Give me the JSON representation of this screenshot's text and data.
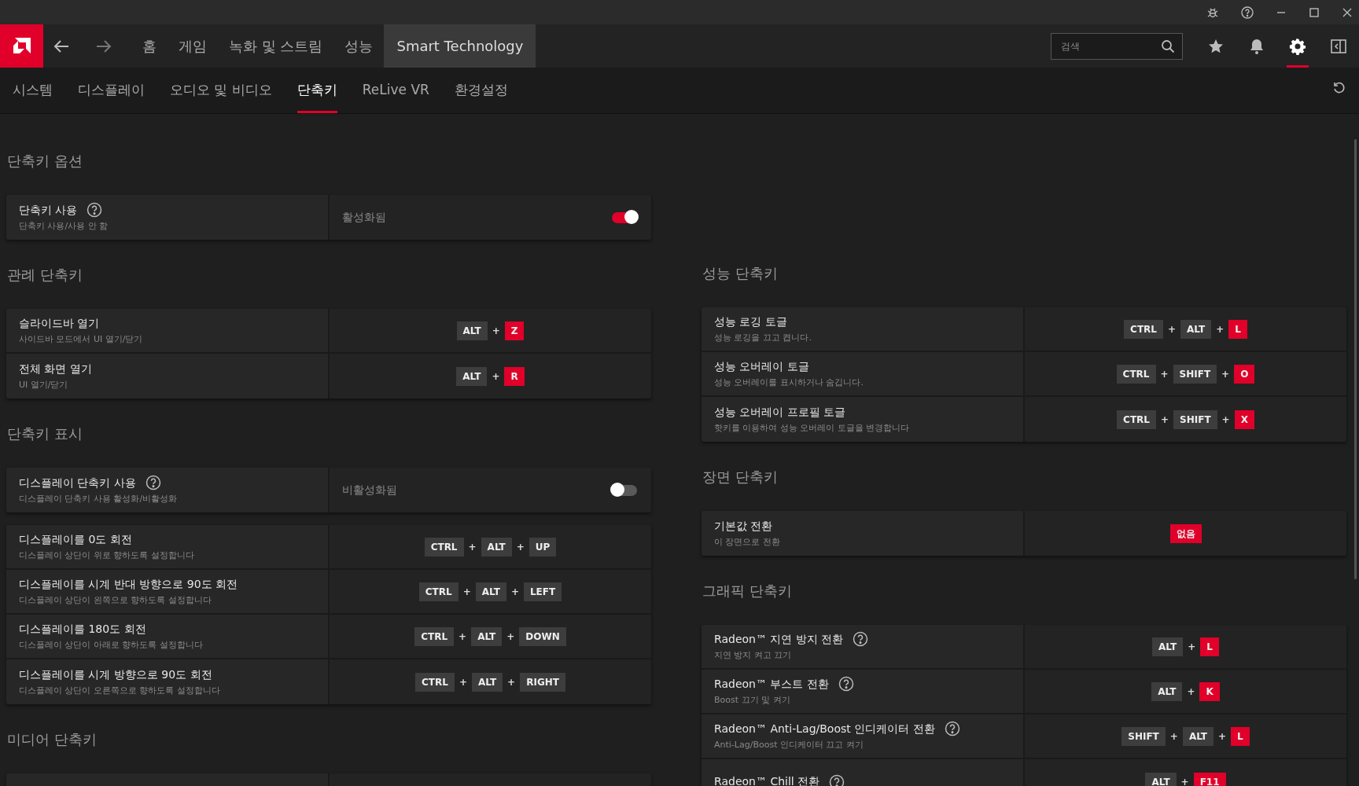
{
  "nav": {
    "items": [
      {
        "label": "홈",
        "selected": false
      },
      {
        "label": "게임",
        "selected": false
      },
      {
        "label": "녹화 및 스트림",
        "selected": false
      },
      {
        "label": "성능",
        "selected": false
      },
      {
        "label": "Smart Technology",
        "selected": true
      }
    ],
    "search": {
      "placeholder": "검색"
    },
    "tools": [
      {
        "kind": "star",
        "selected": false
      },
      {
        "kind": "bell",
        "selected": false
      },
      {
        "kind": "gear",
        "selected": true
      },
      {
        "kind": "sidebar",
        "selected": false
      }
    ]
  },
  "tabs": [
    {
      "label": "시스템",
      "selected": false
    },
    {
      "label": "디스플레이",
      "selected": false
    },
    {
      "label": "오디오 및 비디오",
      "selected": false
    },
    {
      "label": "단축키",
      "selected": true
    },
    {
      "label": "ReLive VR",
      "selected": false
    },
    {
      "label": "환경설정",
      "selected": false
    }
  ],
  "left": [
    {
      "title": "단축키 옵션",
      "cards": [
        [
          {
            "kind": "toggle",
            "title": "단축키 사용",
            "help": true,
            "subtitle": "단축키 사용/사용 안 함",
            "status": "활성화됨",
            "on": true
          }
        ]
      ]
    },
    {
      "title": "관례 단축키",
      "cards": [
        [
          {
            "kind": "keys",
            "title": "슬라이드바 열기",
            "subtitle": "사이드바 모드에서 UI 열기/닫기",
            "keys": [
              {
                "label": "ALT",
                "highlight": false
              },
              {
                "joiner": "+",
                "label": "Z",
                "highlight": true
              }
            ]
          },
          {
            "kind": "keys",
            "title": "전체 화면 열기",
            "subtitle": "UI 열기/닫기",
            "keys": [
              {
                "label": "ALT",
                "highlight": false
              },
              {
                "joiner": "+",
                "label": "R",
                "highlight": true
              }
            ]
          }
        ]
      ]
    },
    {
      "title": "단축키 표시",
      "cards": [
        [
          {
            "kind": "toggle",
            "title": "디스플레이 단축키 사용",
            "help": true,
            "subtitle": "디스플레이 단축키 사용 활성화/비활성화",
            "status": "비활성화됨",
            "on": false
          }
        ],
        [
          {
            "kind": "keys",
            "title": "디스플레이를 0도 회전",
            "subtitle": "디스플레이 상단이 위로 향하도록 설정합니다",
            "keys": [
              {
                "label": "CTRL",
                "highlight": false
              },
              {
                "joiner": "+",
                "label": "ALT",
                "highlight": false
              },
              {
                "joiner": "+",
                "label": "UP",
                "highlight": false
              }
            ]
          },
          {
            "kind": "keys",
            "title": "디스플레이를 시계 반대 방향으로 90도 회전",
            "subtitle": "디스플레이 상단이 왼쪽으로 향하도록 설정합니다",
            "keys": [
              {
                "label": "CTRL",
                "highlight": false
              },
              {
                "joiner": "+",
                "label": "ALT",
                "highlight": false
              },
              {
                "joiner": "+",
                "label": "LEFT",
                "highlight": false
              }
            ]
          },
          {
            "kind": "keys",
            "title": "디스플레이를 180도 회전",
            "subtitle": "디스플레이 상단이 아래로 향하도록 설정합니다",
            "keys": [
              {
                "label": "CTRL",
                "highlight": false
              },
              {
                "joiner": "+",
                "label": "ALT",
                "highlight": false
              },
              {
                "joiner": "+",
                "label": "DOWN",
                "highlight": false
              }
            ]
          },
          {
            "kind": "keys",
            "title": "디스플레이를 시계 방향으로 90도 회전",
            "subtitle": "디스플레이 상단이 오른쪽으로 향하도록 설정합니다",
            "keys": [
              {
                "label": "CTRL",
                "highlight": false
              },
              {
                "joiner": "+",
                "label": "ALT",
                "highlight": false
              },
              {
                "joiner": "+",
                "label": "RIGHT",
                "highlight": false
              }
            ]
          }
        ]
      ]
    },
    {
      "title": "미디어 단축키",
      "cards": [
        [
          {
            "kind": "keys"
          }
        ]
      ]
    }
  ],
  "right": [
    {
      "title": "성능 단축키",
      "cards": [
        [
          {
            "kind": "keys",
            "title": "성능 로깅 토글",
            "subtitle": "성능 로깅을 끄고 켭니다.",
            "keys": [
              {
                "label": "CTRL",
                "highlight": false
              },
              {
                "joiner": "+",
                "label": "ALT",
                "highlight": false
              },
              {
                "joiner": "+",
                "label": "L",
                "highlight": true
              }
            ]
          },
          {
            "kind": "keys",
            "title": "성능 오버레이 토글",
            "subtitle": "성능 오버레이를 표시하거나 숨깁니다.",
            "keys": [
              {
                "label": "CTRL",
                "highlight": false
              },
              {
                "joiner": "+",
                "label": "SHIFT",
                "highlight": false
              },
              {
                "joiner": "+",
                "label": "O",
                "highlight": true
              }
            ]
          },
          {
            "kind": "keys",
            "title": "성능 오버레이 프로필 토글",
            "subtitle": "핫키를 이용하여 성능 오버레이 토글을 변경합니다",
            "keys": [
              {
                "label": "CTRL",
                "highlight": false
              },
              {
                "joiner": "+",
                "label": "SHIFT",
                "highlight": false
              },
              {
                "joiner": "+",
                "label": "X",
                "highlight": true
              }
            ]
          }
        ]
      ]
    },
    {
      "title": "장면 단축키",
      "cards": [
        [
          {
            "kind": "keys",
            "title": "기본값 전환",
            "subtitle": "이 장면으로 전환",
            "keys": [
              {
                "label": "없음",
                "highlight": true
              }
            ]
          }
        ]
      ]
    },
    {
      "title": "그래픽 단축키",
      "cards": [
        [
          {
            "kind": "keys",
            "title": "Radeon™ 지연 방지 전환",
            "help": true,
            "subtitle": "지연 방지 켜고 끄기",
            "keys": [
              {
                "label": "ALT",
                "highlight": false
              },
              {
                "joiner": "+",
                "label": "L",
                "highlight": true
              }
            ]
          },
          {
            "kind": "keys",
            "title": "Radeon™ 부스트 전환",
            "help": true,
            "subtitle": "Boost 끄기 및 켜기",
            "keys": [
              {
                "label": "ALT",
                "highlight": false
              },
              {
                "joiner": "+",
                "label": "K",
                "highlight": true
              }
            ]
          },
          {
            "kind": "keys",
            "title": "Radeon™ Anti-Lag/Boost 인디케이터 전환",
            "help": true,
            "subtitle": "Anti-Lag/Boost 인디케이터 끄고 켜기",
            "keys": [
              {
                "label": "SHIFT",
                "highlight": false
              },
              {
                "joiner": "+",
                "label": "ALT",
                "highlight": false
              },
              {
                "joiner": "+",
                "label": "L",
                "highlight": true
              }
            ]
          },
          {
            "kind": "keys",
            "title": "Radeon™ Chill 전환",
            "help": true,
            "keys": [
              {
                "label": "ALT",
                "highlight": false
              },
              {
                "joiner": "+",
                "label": "F11",
                "highlight": true
              }
            ]
          }
        ]
      ]
    }
  ]
}
